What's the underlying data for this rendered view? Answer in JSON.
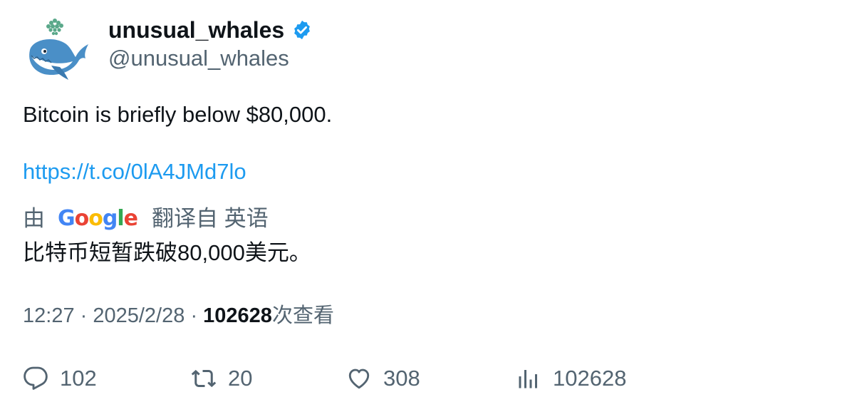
{
  "author": {
    "display_name": "unusual_whales",
    "handle": "@unusual_whales",
    "verified": true,
    "avatar_icon": "whale-icon"
  },
  "tweet": {
    "text": "Bitcoin is briefly below $80,000.",
    "link": "https://t.co/0lA4JMd7lo"
  },
  "translation": {
    "by_label": "由",
    "provider": "Google",
    "from_label": "翻译自 英语",
    "text": "比特币短暂跌破80,000美元。"
  },
  "meta": {
    "time": "12:27",
    "date": "2025/2/28",
    "views": "102628",
    "views_label": "次查看"
  },
  "actions": {
    "replies": "102",
    "retweets": "20",
    "likes": "308",
    "views": "102628"
  },
  "colors": {
    "link": "#1d9bf0",
    "secondary_text": "#536471",
    "verified_badge": "#1d9bf0"
  }
}
